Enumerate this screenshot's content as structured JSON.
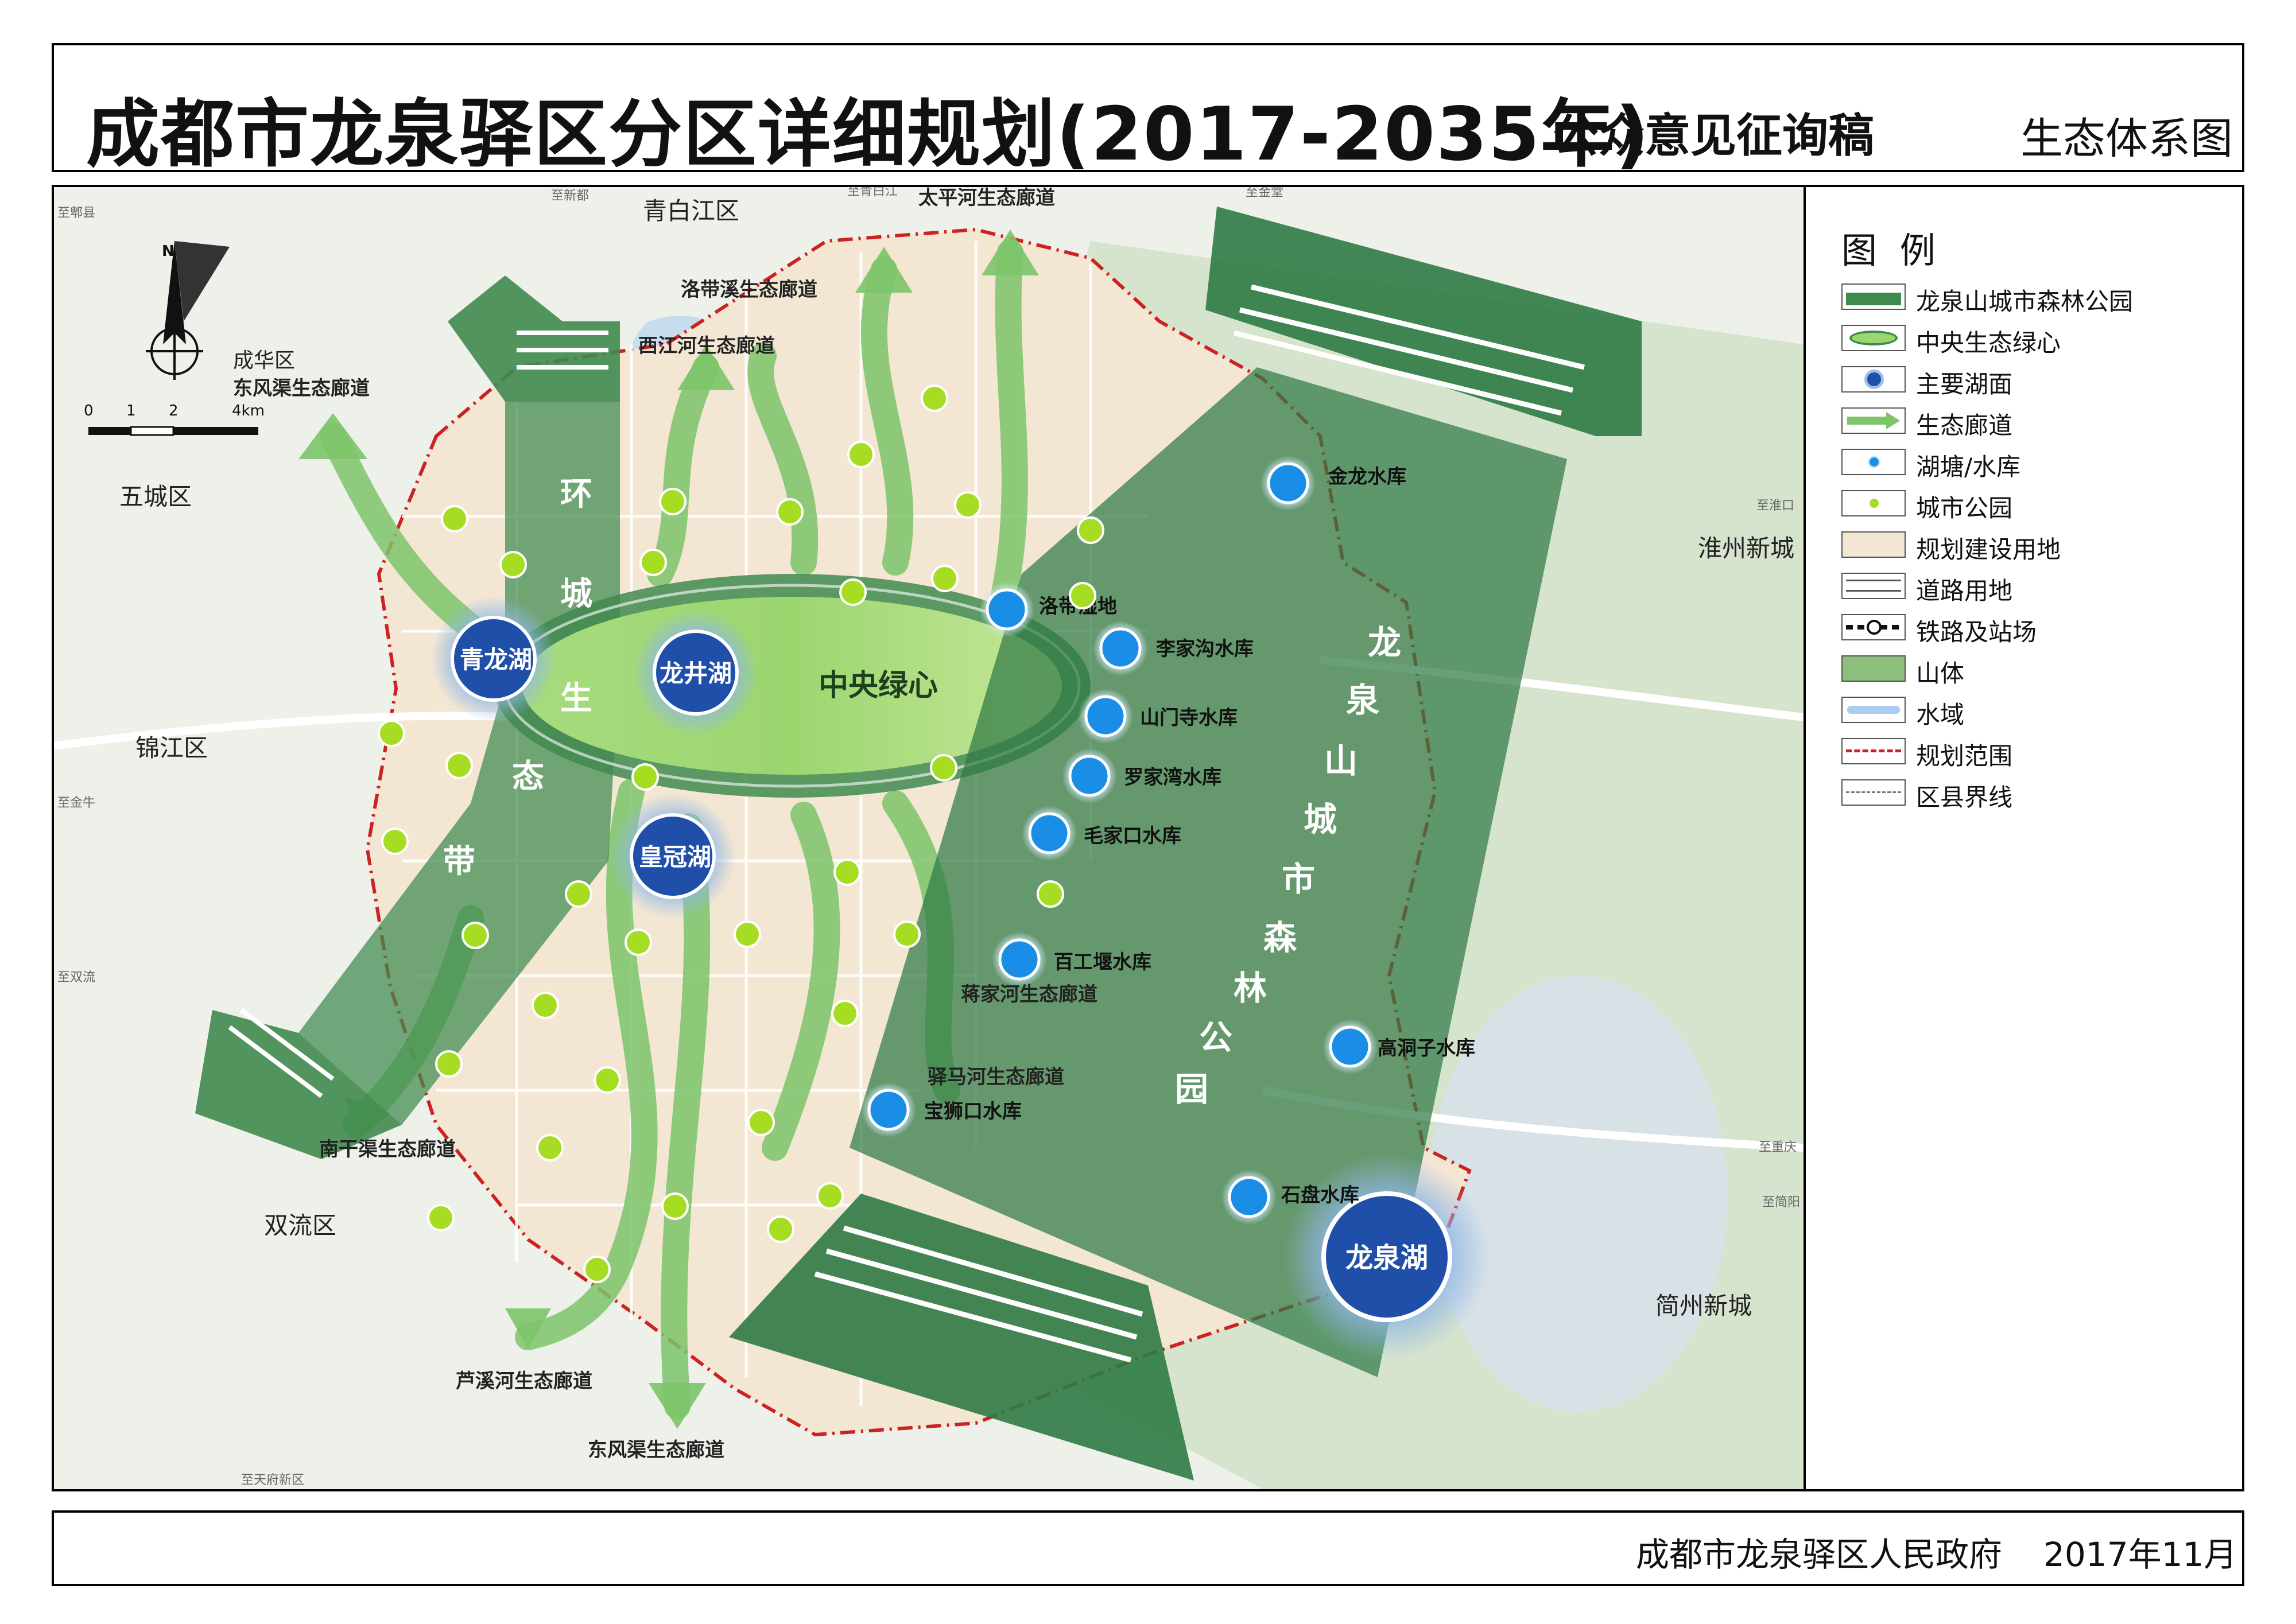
{
  "title": {
    "main": "成都市龙泉驿区分区详细规划(2017-2035年)",
    "sub": "公众意见征询稿",
    "map_name": "生态体系图"
  },
  "footer": {
    "org": "成都市龙泉驿区人民政府",
    "date": "2017年11月"
  },
  "legend": {
    "title": "图 例",
    "items": [
      {
        "label": "龙泉山城市森林公园",
        "icon": "forest-park-band"
      },
      {
        "label": "中央生态绿心",
        "icon": "green-heart-ellipse"
      },
      {
        "label": "主要湖面",
        "icon": "major-lake-dot"
      },
      {
        "label": "生态廊道",
        "icon": "corridor-arrow"
      },
      {
        "label": "湖塘/水库",
        "icon": "reservoir-dot"
      },
      {
        "label": "城市公园",
        "icon": "park-dot"
      },
      {
        "label": "规划建设用地",
        "icon": "landuse-fill"
      },
      {
        "label": "道路用地",
        "icon": "road-line"
      },
      {
        "label": "铁路及站场",
        "icon": "railway-station"
      },
      {
        "label": "山体",
        "icon": "mountain-fill"
      },
      {
        "label": "水域",
        "icon": "water-fill"
      },
      {
        "label": "规划范围",
        "icon": "plan-boundary-line"
      },
      {
        "label": "区县界线",
        "icon": "county-border-line"
      }
    ]
  },
  "scale": {
    "ticks": [
      "0",
      "1",
      "2"
    ],
    "unit": "4km",
    "north": "N"
  },
  "colors": {
    "belt": "#3f8a4f",
    "belt_dark": "#2f6f3f",
    "green_heart": "#8fd06a",
    "lake": "#1f4fa8",
    "reservoir": "#1a8ee6",
    "park": "#a6dd22",
    "landuse": "#f3e7d3",
    "boundary": "#cc2222",
    "water": "#bcd8ef"
  },
  "map": {
    "districts": [
      "青白江区",
      "五城区",
      "锦江区",
      "双流区",
      "淮州新城",
      "简州新城",
      "成华区"
    ],
    "belts": [
      "环城生态带",
      "龙泉山城市森林公园"
    ],
    "belt_chars": {
      "ring": [
        "环",
        "城",
        "生",
        "态",
        "带"
      ],
      "forest": [
        "龙",
        "泉",
        "山",
        "城",
        "市",
        "森",
        "林",
        "公",
        "园"
      ]
    },
    "green_heart": "中央绿心",
    "major_lakes": [
      "青龙湖",
      "龙井湖",
      "皇冠湖",
      "龙泉湖"
    ],
    "reservoirs": [
      "金龙水库",
      "洛带湿地",
      "李家沟水库",
      "山门寺水库",
      "罗家湾水库",
      "毛家口水库",
      "百工堰水库",
      "高洞子水库",
      "宝狮口水库",
      "石盘水库"
    ],
    "corridors": [
      "太平河生态廊道",
      "洛带溪生态廊道",
      "西江河生态廊道",
      "东风渠生态廊道",
      "蒋家河生态廊道",
      "驿马河生态廊道",
      "南干渠生态廊道",
      "芦溪河生态廊道",
      "东风渠生态廊道"
    ],
    "road_labels": [
      "至郫县",
      "至新都",
      "至青白江",
      "至金堂",
      "至淮口",
      "至简阳",
      "至重庆",
      "至双流",
      "至天府新区",
      "至金牛"
    ]
  }
}
